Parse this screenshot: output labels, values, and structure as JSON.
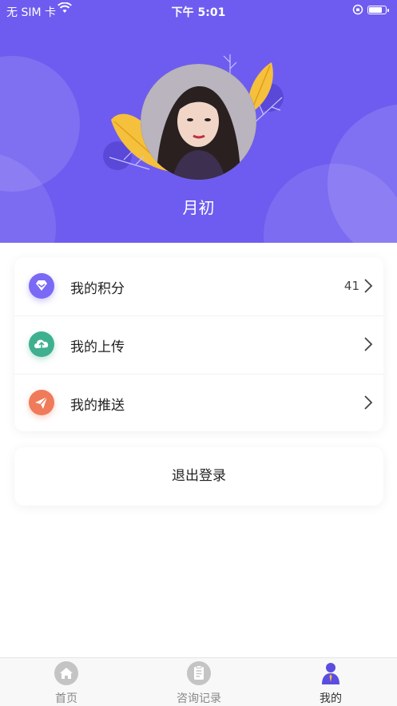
{
  "status_bar": {
    "carrier": "无 SIM 卡",
    "time": "下午 5:01",
    "battery_level": 0.85
  },
  "profile": {
    "username": "月初",
    "avatar_icon": "user-avatar-photo"
  },
  "menu": {
    "items": [
      {
        "label": "我的积分",
        "value": "41",
        "icon": "points-diamond-icon",
        "color": "#6e5cf0"
      },
      {
        "label": "我的上传",
        "value": "",
        "icon": "cloud-upload-icon",
        "color": "#3fb08f"
      },
      {
        "label": "我的推送",
        "value": "",
        "icon": "paper-plane-icon",
        "color": "#ef7b5a"
      }
    ]
  },
  "logout": {
    "label": "退出登录"
  },
  "tabbar": {
    "tabs": [
      {
        "label": "首页",
        "icon": "home-icon",
        "active": false
      },
      {
        "label": "咨询记录",
        "icon": "record-clipboard-icon",
        "active": false
      },
      {
        "label": "我的",
        "icon": "profile-person-icon",
        "active": true
      }
    ]
  },
  "colors": {
    "header_bg": "#6e5cf0",
    "accent_leaf": "#f5c03c",
    "tab_inactive": "#bbbbbb",
    "tab_active": "#5b4de0"
  }
}
